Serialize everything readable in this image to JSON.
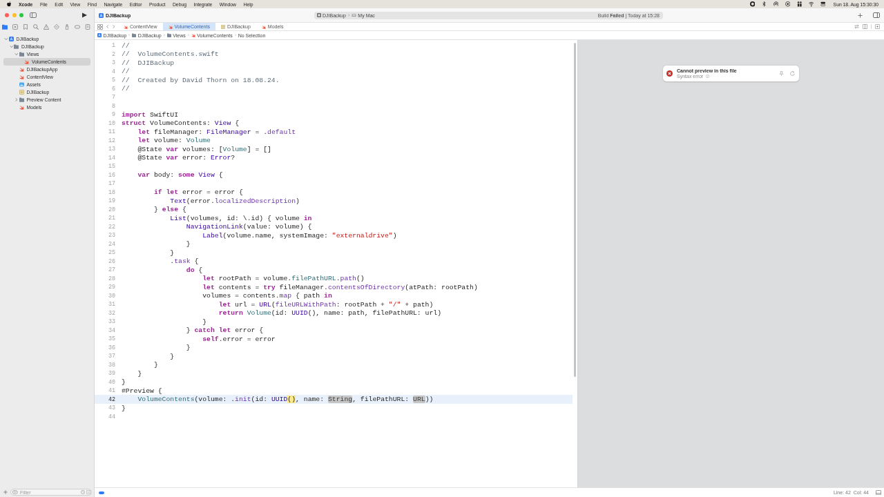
{
  "menu_bar": {
    "app": "Xcode",
    "menus": [
      "File",
      "Edit",
      "View",
      "Find",
      "Navigate",
      "Editor",
      "Product",
      "Debug",
      "Integrate",
      "Window",
      "Help"
    ],
    "clock": "Sun 18. Aug 15:30:30"
  },
  "toolbar": {
    "project": "DJIBackup",
    "scheme": "DJIBackup",
    "destination": "My Mac",
    "status": "Build **Failed** | Today at 15:28"
  },
  "sidebar": {
    "navigator": [
      {
        "selected": true
      },
      {
        "selected": false
      },
      {
        "selected": false
      },
      {
        "selected": false
      },
      {
        "selected": false
      },
      {
        "selected": false
      },
      {
        "selected": false
      },
      {
        "selected": false
      },
      {
        "selected": false
      }
    ],
    "tree": [
      {
        "label": "DJIBackup",
        "kind": "project",
        "expanded": true,
        "selected": false,
        "children": [
          {
            "label": "DJIBackup",
            "kind": "folder",
            "expanded": true,
            "selected": false,
            "children": [
              {
                "label": "Views",
                "kind": "folder",
                "expanded": true,
                "selected": false,
                "children": [
                  {
                    "label": "VolumeContents",
                    "kind": "swift",
                    "selected": true
                  }
                ]
              },
              {
                "label": "DJIBackupApp",
                "kind": "swift",
                "selected": false
              },
              {
                "label": "ContentView",
                "kind": "swift",
                "selected": false
              },
              {
                "label": "Assets",
                "kind": "assets",
                "selected": false
              },
              {
                "label": "DJIBackup",
                "kind": "plist",
                "selected": false
              },
              {
                "label": "Preview Content",
                "kind": "folder",
                "expanded": false,
                "selected": false
              },
              {
                "label": "Models",
                "kind": "swift",
                "selected": false
              }
            ]
          }
        ]
      }
    ],
    "filter": {
      "placeholder": "Filter"
    }
  },
  "tabs": [
    {
      "label": "ContentView",
      "kind": "swift",
      "selected": false
    },
    {
      "label": "VolumeContents",
      "kind": "swift",
      "selected": true
    },
    {
      "label": "DJIBackup",
      "kind": "plist",
      "selected": false
    },
    {
      "label": "Models",
      "kind": "swift",
      "selected": false
    }
  ],
  "breadcrumb": [
    {
      "label": "DJIBackup",
      "kind": "project"
    },
    {
      "label": "DJIBackup",
      "kind": "folder"
    },
    {
      "label": "Views",
      "kind": "folder"
    },
    {
      "label": "VolumeContents",
      "kind": "swift"
    },
    {
      "label": "No Selection"
    }
  ],
  "editor": {
    "lines": [
      {
        "number": "1",
        "current": false,
        "tokens": [
          {
            "kind": "comment",
            "text": "//"
          }
        ]
      },
      {
        "number": "2",
        "current": false,
        "tokens": [
          {
            "kind": "comment",
            "text": "//  VolumeContents.swift"
          }
        ]
      },
      {
        "number": "3",
        "current": false,
        "tokens": [
          {
            "kind": "comment",
            "text": "//  DJIBackup"
          }
        ]
      },
      {
        "number": "4",
        "current": false,
        "tokens": [
          {
            "kind": "comment",
            "text": "//"
          }
        ]
      },
      {
        "number": "5",
        "current": false,
        "tokens": [
          {
            "kind": "comment",
            "text": "//  Created by David Thorn on 18.08.24."
          }
        ]
      },
      {
        "number": "6",
        "current": false,
        "tokens": [
          {
            "kind": "comment",
            "text": "//"
          }
        ]
      },
      {
        "number": "7",
        "current": false
      },
      {
        "number": "8",
        "current": false
      },
      {
        "number": "9",
        "current": false,
        "tokens": [
          {
            "kind": "keyword",
            "text": "import"
          },
          {
            "kind": "plain",
            "text": " SwiftUI"
          }
        ]
      },
      {
        "number": "10",
        "current": false,
        "tokens": [
          {
            "kind": "keyword",
            "text": "struct"
          },
          {
            "kind": "plain",
            "text": " VolumeContents: "
          },
          {
            "kind": "type",
            "text": "View"
          },
          {
            "kind": "plain",
            "text": " {"
          }
        ]
      },
      {
        "number": "11",
        "current": false,
        "tokens": [
          {
            "kind": "keyword",
            "text": "    let"
          },
          {
            "kind": "plain",
            "text": " fileManager: "
          },
          {
            "kind": "type",
            "text": "FileManager"
          },
          {
            "kind": "plain",
            "text": " = ."
          },
          {
            "kind": "member",
            "text": "default"
          }
        ]
      },
      {
        "number": "12",
        "current": false,
        "tokens": [
          {
            "kind": "keyword",
            "text": "    let"
          },
          {
            "kind": "plain",
            "text": " volume: "
          },
          {
            "kind": "project",
            "text": "Volume"
          }
        ]
      },
      {
        "number": "13",
        "current": false,
        "tokens": [
          {
            "kind": "plain",
            "text": "    @State "
          },
          {
            "kind": "keyword",
            "text": "var"
          },
          {
            "kind": "plain",
            "text": " volumes: ["
          },
          {
            "kind": "project",
            "text": "Volume"
          },
          {
            "kind": "plain",
            "text": "] = []"
          }
        ]
      },
      {
        "number": "14",
        "current": false,
        "tokens": [
          {
            "kind": "plain",
            "text": "    @State "
          },
          {
            "kind": "keyword",
            "text": "var"
          },
          {
            "kind": "plain",
            "text": " error: "
          },
          {
            "kind": "type",
            "text": "Error"
          },
          {
            "kind": "plain",
            "text": "?"
          }
        ]
      },
      {
        "number": "15",
        "current": false
      },
      {
        "number": "16",
        "current": false,
        "tokens": [
          {
            "kind": "keyword",
            "text": "    var"
          },
          {
            "kind": "plain",
            "text": " body: "
          },
          {
            "kind": "keyword",
            "text": "some"
          },
          {
            "kind": "type",
            "text": " View"
          },
          {
            "kind": "plain",
            "text": " {"
          }
        ]
      },
      {
        "number": "17",
        "current": false
      },
      {
        "number": "18",
        "current": false,
        "tokens": [
          {
            "kind": "keyword",
            "text": "        if"
          },
          {
            "kind": "keyword",
            "text": " let"
          },
          {
            "kind": "plain",
            "text": " error = error {"
          }
        ]
      },
      {
        "number": "19",
        "current": false,
        "tokens": [
          {
            "kind": "type",
            "text": "            Text"
          },
          {
            "kind": "plain",
            "text": "(error."
          },
          {
            "kind": "member",
            "text": "localizedDescription"
          },
          {
            "kind": "plain",
            "text": ")"
          }
        ]
      },
      {
        "number": "20",
        "current": false,
        "tokens": [
          {
            "kind": "plain",
            "text": "        } "
          },
          {
            "kind": "keyword",
            "text": "else"
          },
          {
            "kind": "plain",
            "text": " {"
          }
        ]
      },
      {
        "number": "21",
        "current": false,
        "tokens": [
          {
            "kind": "type",
            "text": "            List"
          },
          {
            "kind": "plain",
            "text": "(volumes, id: \\.id) { volume "
          },
          {
            "kind": "keyword",
            "text": "in"
          }
        ]
      },
      {
        "number": "22",
        "current": false,
        "tokens": [
          {
            "kind": "type",
            "text": "                NavigationLink"
          },
          {
            "kind": "plain",
            "text": "(value: volume) {"
          }
        ]
      },
      {
        "number": "23",
        "current": false,
        "tokens": [
          {
            "kind": "type",
            "text": "                    Label"
          },
          {
            "kind": "plain",
            "text": "(volume.name, systemImage: "
          },
          {
            "kind": "string",
            "text": "\"externaldrive\""
          },
          {
            "kind": "plain",
            "text": ")"
          }
        ]
      },
      {
        "number": "24",
        "current": false,
        "tokens": [
          {
            "kind": "plain",
            "text": "                }"
          }
        ]
      },
      {
        "number": "25",
        "current": false,
        "tokens": [
          {
            "kind": "plain",
            "text": "            }"
          }
        ]
      },
      {
        "number": "26",
        "current": false,
        "tokens": [
          {
            "kind": "plain",
            "text": "            ."
          },
          {
            "kind": "member",
            "text": "task"
          },
          {
            "kind": "plain",
            "text": " {"
          }
        ]
      },
      {
        "number": "27",
        "current": false,
        "tokens": [
          {
            "kind": "keyword",
            "text": "                do"
          },
          {
            "kind": "plain",
            "text": " {"
          }
        ]
      },
      {
        "number": "28",
        "current": false,
        "tokens": [
          {
            "kind": "keyword",
            "text": "                    let"
          },
          {
            "kind": "plain",
            "text": " rootPath = volume."
          },
          {
            "kind": "project",
            "text": "filePathURL"
          },
          {
            "kind": "plain",
            "text": "."
          },
          {
            "kind": "member",
            "text": "path"
          },
          {
            "kind": "plain",
            "text": "()"
          }
        ]
      },
      {
        "number": "29",
        "current": false,
        "tokens": [
          {
            "kind": "keyword",
            "text": "                    let"
          },
          {
            "kind": "plain",
            "text": " contents = "
          },
          {
            "kind": "keyword",
            "text": "try"
          },
          {
            "kind": "plain",
            "text": " fileManager."
          },
          {
            "kind": "member",
            "text": "contentsOfDirectory"
          },
          {
            "kind": "plain",
            "text": "(atPath: rootPath)"
          }
        ]
      },
      {
        "number": "30",
        "current": false,
        "tokens": [
          {
            "kind": "plain",
            "text": "                    volumes = contents."
          },
          {
            "kind": "member",
            "text": "map"
          },
          {
            "kind": "plain",
            "text": " { path "
          },
          {
            "kind": "keyword",
            "text": "in"
          }
        ]
      },
      {
        "number": "31",
        "current": false,
        "tokens": [
          {
            "kind": "keyword",
            "text": "                        let"
          },
          {
            "kind": "plain",
            "text": " url = "
          },
          {
            "kind": "type",
            "text": "URL"
          },
          {
            "kind": "plain",
            "text": "("
          },
          {
            "kind": "member",
            "text": "fileURLWithPath"
          },
          {
            "kind": "plain",
            "text": ": rootPath + "
          },
          {
            "kind": "string",
            "text": "\"/\""
          },
          {
            "kind": "plain",
            "text": " + path)"
          }
        ]
      },
      {
        "number": "32",
        "current": false,
        "tokens": [
          {
            "kind": "keyword",
            "text": "                        return"
          },
          {
            "kind": "project",
            "text": " Volume"
          },
          {
            "kind": "plain",
            "text": "(id: "
          },
          {
            "kind": "type",
            "text": "UUID"
          },
          {
            "kind": "plain",
            "text": "(), name: path, filePathURL: url)"
          }
        ]
      },
      {
        "number": "33",
        "current": false,
        "tokens": [
          {
            "kind": "plain",
            "text": "                    }"
          }
        ]
      },
      {
        "number": "34",
        "current": false,
        "tokens": [
          {
            "kind": "plain",
            "text": "                } "
          },
          {
            "kind": "keyword",
            "text": "catch"
          },
          {
            "kind": "keyword",
            "text": " let"
          },
          {
            "kind": "plain",
            "text": " error {"
          }
        ]
      },
      {
        "number": "35",
        "current": false,
        "tokens": [
          {
            "kind": "keyword",
            "text": "                    self"
          },
          {
            "kind": "plain",
            "text": ".error = error"
          }
        ]
      },
      {
        "number": "36",
        "current": false,
        "tokens": [
          {
            "kind": "plain",
            "text": "                }"
          }
        ]
      },
      {
        "number": "37",
        "current": false,
        "tokens": [
          {
            "kind": "plain",
            "text": "            }"
          }
        ]
      },
      {
        "number": "38",
        "current": false,
        "tokens": [
          {
            "kind": "plain",
            "text": "        }"
          }
        ]
      },
      {
        "number": "39",
        "current": false,
        "tokens": [
          {
            "kind": "plain",
            "text": "    }"
          }
        ]
      },
      {
        "number": "40",
        "current": false,
        "tokens": [
          {
            "kind": "plain",
            "text": "}"
          }
        ]
      },
      {
        "number": "41",
        "current": false,
        "tokens": [
          {
            "kind": "plain",
            "text": "#Preview {"
          }
        ]
      },
      {
        "number": "42",
        "current": true,
        "tokens": [
          {
            "kind": "project",
            "text": "    VolumeContents"
          },
          {
            "kind": "plain",
            "text": "(volume: ."
          },
          {
            "kind": "member",
            "text": "init"
          },
          {
            "kind": "plain",
            "text": "(id: "
          },
          {
            "kind": "type",
            "text": "UUID"
          },
          {
            "kind": "match",
            "text": "()"
          },
          {
            "kind": "plain",
            "text": ", name: "
          },
          {
            "kind": "placeholder",
            "text": "String"
          },
          {
            "kind": "plain",
            "text": ", filePathURL: "
          },
          {
            "kind": "placeholder",
            "text": "URL"
          },
          {
            "kind": "plain",
            "text": "))"
          }
        ]
      },
      {
        "number": "43",
        "current": false,
        "tokens": [
          {
            "kind": "plain",
            "text": "}"
          }
        ]
      },
      {
        "number": "44",
        "current": false
      }
    ]
  },
  "preview": {
    "title": "Cannot preview in this file",
    "detail": "Syntax error"
  },
  "status_bar": {
    "line": "Line: 42",
    "column": "Col: 44"
  }
}
